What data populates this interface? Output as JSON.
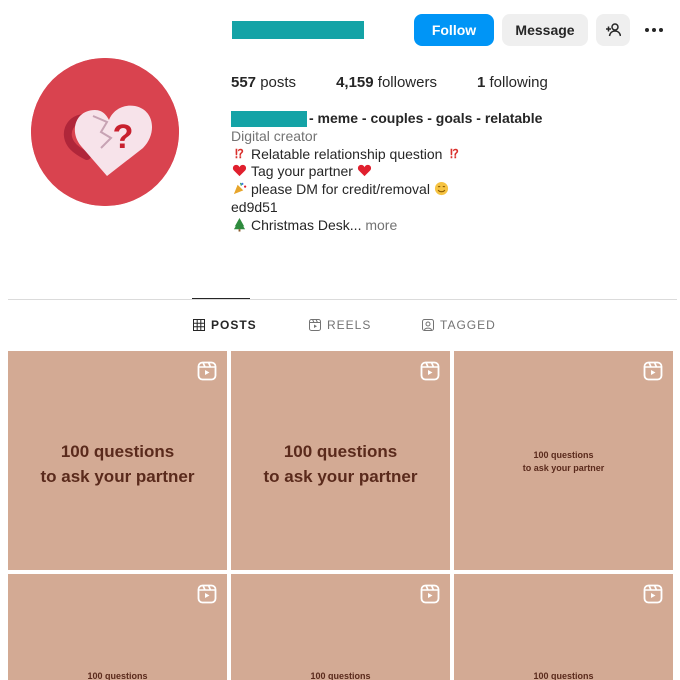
{
  "profile": {
    "follow_label": "Follow",
    "message_label": "Message",
    "icons": {
      "suggest": "add-person-icon",
      "more": "more-options-icon"
    }
  },
  "stats": {
    "posts_count": "557",
    "posts_label": "posts",
    "followers_count": "4,159",
    "followers_label": "followers",
    "following_count": "1",
    "following_label": "following"
  },
  "bio": {
    "title_suffix": "- meme - couples - goals - relatable",
    "category": "Digital creator",
    "line1": "Relatable relationship question",
    "line2": "Tag your partner",
    "line3": "please DM for credit/removal",
    "line4": "ed9d51",
    "line5": "Christmas Desk...",
    "more_label": "more"
  },
  "tabs": {
    "posts": "POSTS",
    "reels": "REELS",
    "tagged": "TAGGED"
  },
  "posts": [
    {
      "line1": "100 questions",
      "line2": "to ask your partner"
    },
    {
      "line1": "100 questions",
      "line2": "to ask your partner"
    },
    {
      "line1": "100 questions",
      "line2": "to ask your partner"
    },
    {
      "line1": "100 questions"
    },
    {
      "line1": "100 questions"
    },
    {
      "line1": "100 questions"
    }
  ],
  "colors": {
    "follow": "#0095f6",
    "redaction": "#14a3a6",
    "avatar_bg": "#d9434f",
    "tile_bg": "#d3aa94",
    "tile_text": "#5a2a1c"
  }
}
